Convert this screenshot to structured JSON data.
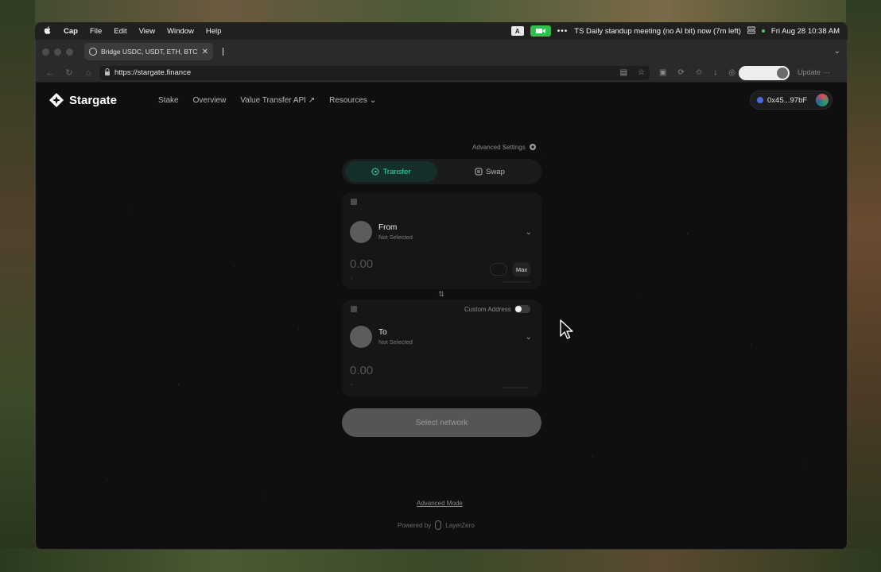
{
  "menubar": {
    "app_name": "Cap",
    "menus": [
      "File",
      "Edit",
      "View",
      "Window",
      "Help"
    ],
    "tray_badge": "A",
    "meeting": "TS Daily standup meeting (no AI bit) now (7m left)",
    "datetime": "Fri Aug 28  10:38 AM"
  },
  "browser": {
    "tab_title": "Bridge USDC, USDT, ETH, BTC",
    "url": "https://stargate.finance",
    "update_label": "Update"
  },
  "site": {
    "logo_text": "Stargate",
    "nav": {
      "stake": "Stake",
      "overview": "Overview",
      "vta": "Value Transfer API ↗",
      "resources": "Resources"
    },
    "wallet_address": "0x45...97bF"
  },
  "bridge": {
    "advanced_settings": "Advanced Settings",
    "mode_transfer": "Transfer",
    "mode_swap": "Swap",
    "from_label": "From",
    "from_sub": "Not Selected",
    "from_amount": "0.00",
    "from_dash": "-",
    "max_label": "Max",
    "custom_address": "Custom Address",
    "custom_address_enabled": false,
    "to_label": "To",
    "to_sub": "Not Selected",
    "to_amount": "0.00",
    "to_dash": "-",
    "cta": "Select network",
    "advanced_mode": "Advanced Mode",
    "powered_by": "Powered by",
    "powered_brand": "LayerZero"
  },
  "colors": {
    "accent_teal": "#3bd6ae",
    "page_bg": "#0f0f10",
    "card_bg": "#161617"
  }
}
